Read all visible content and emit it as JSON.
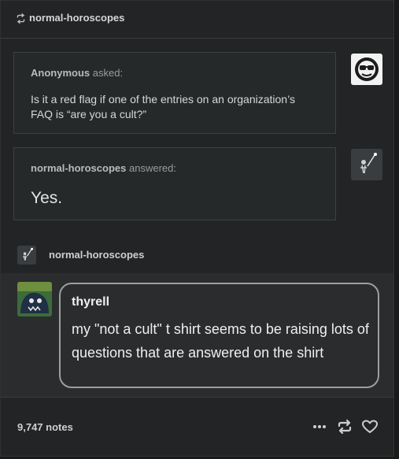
{
  "header": {
    "blog_name": "normal-horoscopes"
  },
  "ask": {
    "asker": "Anonymous",
    "verb": "asked:",
    "question": "Is it a red flag if one of the entries on an organization’s FAQ is “are you a cult?”"
  },
  "answer": {
    "answerer": "normal-horoscopes",
    "verb": "answered:",
    "text": "Yes."
  },
  "reblogger": {
    "name": "normal-horoscopes"
  },
  "reblog": {
    "name": "thyrell",
    "text": "my \"not a cult\" t shirt seems to be raising lots of questions that are answered on the shirt"
  },
  "footer": {
    "notes": "9,747 notes",
    "icons": [
      "more-icon",
      "reblog-icon",
      "like-icon"
    ]
  }
}
